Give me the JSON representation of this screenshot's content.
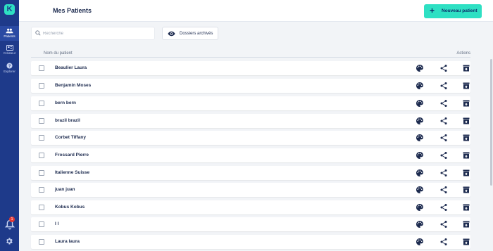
{
  "sidebar": {
    "logo_letter": "K",
    "items": [
      {
        "label": "Patients",
        "icon": "people-icon",
        "active": true
      },
      {
        "label": "Créateur",
        "icon": "creator-icon",
        "active": false
      },
      {
        "label": "Explorer",
        "icon": "help-icon",
        "active": false
      }
    ],
    "notification_count": "1"
  },
  "header": {
    "title": "Mes Patients",
    "new_button_label": "Nouveau patient"
  },
  "toolbar": {
    "search_placeholder": "Recherche",
    "archived_label": "Dossiers archivés"
  },
  "table": {
    "col_name": "Nom du patient",
    "col_actions": "Actions",
    "rows": [
      "Beaulier Laura",
      "Benjamin Moses",
      "bern bern",
      "brazil brazil",
      "Corbet Tiffany",
      "Frossard Pierre",
      "Italienne Suisse",
      "juan juan",
      "Kobus Kobus",
      "l l",
      "Laura laura"
    ]
  },
  "colors": {
    "sidebar": "#1e3a8a",
    "accent": "#2ee0c3",
    "text_dark": "#1d2b4f"
  }
}
